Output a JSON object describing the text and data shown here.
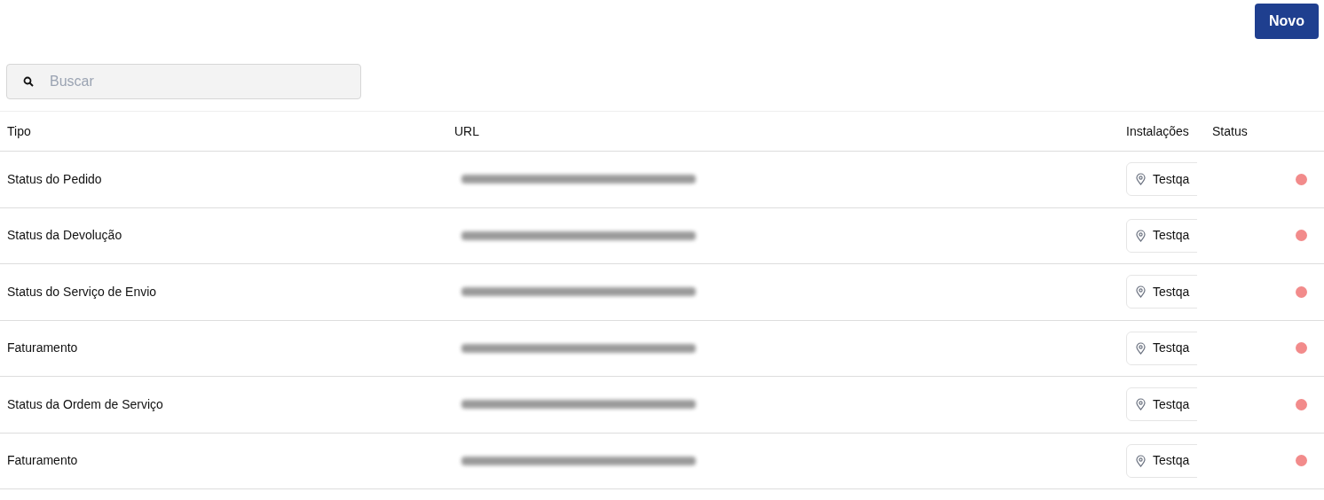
{
  "new_button": "Novo",
  "search": {
    "placeholder": "Buscar"
  },
  "table": {
    "columns": [
      "Tipo",
      "URL",
      "Instalações",
      "Status"
    ],
    "rows": [
      {
        "tipo": "Status do Pedido",
        "url_redacted": true,
        "installation": "Testqa",
        "color": "#f28b8b"
      },
      {
        "tipo": "Status da Devolução",
        "url_redacted": true,
        "installation": "Testqa",
        "color": "#f28b8b"
      },
      {
        "tipo": "Status do Serviço de Envio",
        "url_redacted": true,
        "installation": "Testqa",
        "color": "#f28b8b"
      },
      {
        "tipo": "Faturamento",
        "url_redacted": true,
        "installation": "Testqa",
        "color": "#f28b8b"
      },
      {
        "tipo": "Status da Ordem de Serviço",
        "url_redacted": true,
        "installation": "Testqa",
        "color": "#f28b8b"
      },
      {
        "tipo": "Faturamento",
        "url_redacted": true,
        "installation": "Testqa",
        "color": "#f28b8b"
      }
    ]
  }
}
